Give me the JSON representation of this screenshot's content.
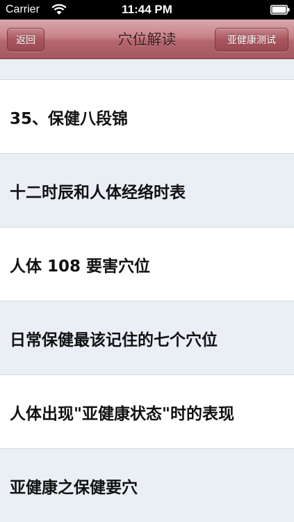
{
  "status_bar": {
    "carrier": "Carrier",
    "time": "11:44 PM"
  },
  "nav": {
    "back_label": "返回",
    "title": "穴位解读",
    "right_button_label": "亚健康测试"
  },
  "list": {
    "items": [
      {
        "label": "35、保健八段锦"
      },
      {
        "label": "十二时辰和人体经络时表"
      },
      {
        "label": "人体 108 要害穴位"
      },
      {
        "label": "日常保健最该记住的七个穴位"
      },
      {
        "label": "人体出现\"亚健康状态\"时的表现"
      },
      {
        "label": "亚健康之保健要穴"
      }
    ]
  },
  "colors": {
    "nav_tint": "#b4676e",
    "row_alt": "#eaeef5"
  }
}
